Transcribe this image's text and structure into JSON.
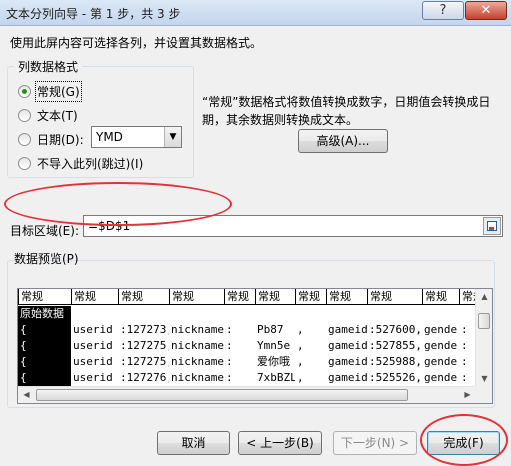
{
  "window": {
    "title": "文本分列向导 - 第 1 步，共 3 步",
    "help_label": "?",
    "close_label": "✕"
  },
  "instruction": "使用此屏内容可选择各列，并设置其数据格式。",
  "column_format": {
    "group_label": "列数据格式",
    "options": [
      {
        "label": "常规(G)",
        "checked": true
      },
      {
        "label": "文本(T)",
        "checked": false
      },
      {
        "label": "日期(D):",
        "checked": false
      },
      {
        "label": "不导入此列(跳过)(I)",
        "checked": false
      }
    ],
    "date_format": "YMD",
    "description": "“常规”数据格式将数值转换成数字，日期值会转换成日期，其余数据则转换成文本。",
    "advanced_label": "高级(A)..."
  },
  "destination": {
    "label": "目标区域(E):",
    "value": "=$D$1"
  },
  "preview": {
    "label": "数据预览(P)",
    "headers": [
      "常规",
      "常规",
      "常规",
      "常规",
      "常规",
      "常规",
      "常规",
      "常规",
      "常规",
      "常规",
      "常规",
      "常规"
    ],
    "rows": [
      [
        "原始数据",
        "",
        "",
        "",
        "",
        "",
        "",
        "",
        "",
        "",
        "",
        ""
      ],
      [
        "{",
        "userid",
        ":127273,",
        "nickname",
        ":",
        "Pb87",
        ",",
        "gameid",
        ":527600,",
        "gender",
        ":",
        ""
      ],
      [
        "{",
        "userid",
        ":127275,",
        "nickname",
        ":",
        "Ymn5e",
        ",",
        "gameid",
        ":527855,",
        "gender",
        ":",
        ""
      ],
      [
        "{",
        "userid",
        ":127275,",
        "nickname",
        ":",
        "爱你哦",
        ",",
        "gameid",
        ":525988,",
        "gender",
        ":",
        ""
      ],
      [
        "{",
        "userid",
        ":127276,",
        "nickname",
        ":",
        "7xbBZL",
        ",",
        "gameid",
        ":525526,",
        "gender",
        ":",
        ""
      ]
    ]
  },
  "buttons": {
    "cancel": "取消",
    "back": "< 上一步(B)",
    "next": "下一步(N) >",
    "finish": "完成(F)"
  }
}
